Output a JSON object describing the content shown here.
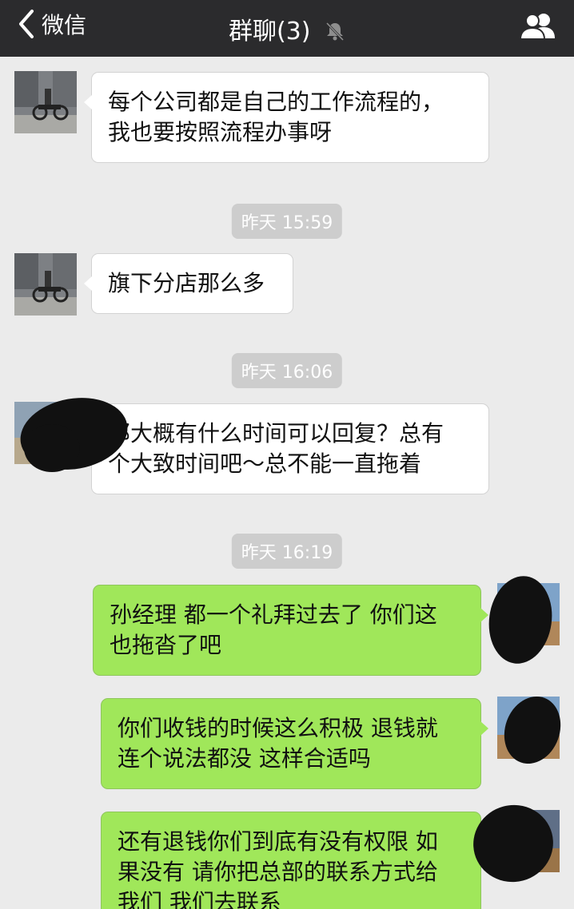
{
  "navbar": {
    "back_label": "微信",
    "title": "群聊(3)"
  },
  "messages": [
    {
      "side": "in",
      "text_lines": [
        "每个公司都是自己的工作流程的，",
        "我也要按照流程办事呀"
      ]
    },
    {
      "time": "昨天 15:59"
    },
    {
      "side": "in",
      "text_lines": [
        "旗下分店那么多"
      ]
    },
    {
      "time": "昨天 16:06"
    },
    {
      "side": "in",
      "text_lines": [
        "那大概有什么时间可以回复？总有",
        "个大致时间吧～总不能一直拖着"
      ]
    },
    {
      "time": "昨天 16:19"
    },
    {
      "side": "out",
      "text_lines": [
        "孙经理 都一个礼拜过去了 你们这",
        "也拖沓了吧"
      ]
    },
    {
      "side": "out",
      "text_lines": [
        "你们收钱的时候这么积极 退钱就",
        "连个说法都没 这样合适吗"
      ]
    },
    {
      "side": "out",
      "text_lines": [
        "还有退钱你们到底有没有权限 如",
        "果没有 请你把总部的联系方式给",
        "我们 我们去联系"
      ]
    }
  ],
  "icons": {
    "back": "chevron-left-icon",
    "mute": "mute-bell-icon",
    "contacts": "group-members-icon"
  },
  "colors": {
    "navbar": "#2b2b2d",
    "background": "#ebebeb",
    "incoming_bubble": "#ffffff",
    "outgoing_bubble": "#a0e75a",
    "timestamp_bg": "#cdcdcd"
  }
}
